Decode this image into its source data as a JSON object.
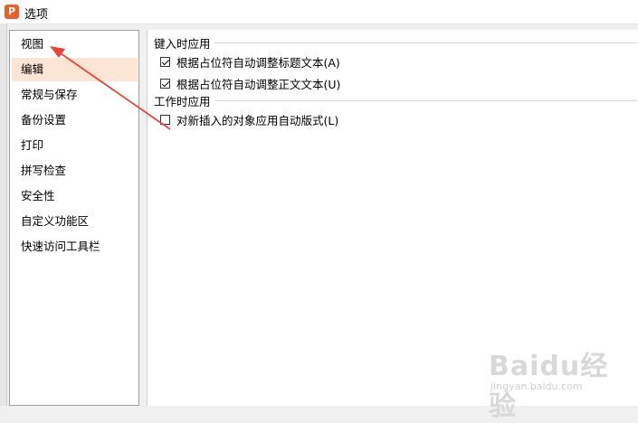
{
  "window": {
    "title": "选项",
    "app_icon_letter": "P",
    "accent_color": "#e8612a"
  },
  "sidebar": {
    "items": [
      {
        "label": "视图",
        "selected": false
      },
      {
        "label": "编辑",
        "selected": true
      },
      {
        "label": "常规与保存",
        "selected": false
      },
      {
        "label": "备份设置",
        "selected": false
      },
      {
        "label": "打印",
        "selected": false
      },
      {
        "label": "拼写检查",
        "selected": false
      },
      {
        "label": "安全性",
        "selected": false
      },
      {
        "label": "自定义功能区",
        "selected": false
      },
      {
        "label": "快速访问工具栏",
        "selected": false
      }
    ]
  },
  "content": {
    "group1": {
      "label": "键入时应用",
      "options": [
        {
          "label": "根据占位符自动调整标题文本(A)",
          "checked": true
        },
        {
          "label": "根据占位符自动调整正文文本(U)",
          "checked": true
        }
      ]
    },
    "group2": {
      "label": "工作时应用",
      "options": [
        {
          "label": "对新插入的对象应用自动版式(L)",
          "checked": false
        }
      ]
    }
  },
  "annotation": {
    "arrow_color": "#e8463c"
  },
  "watermark": {
    "logo": "Baidu经验",
    "url": "jingyan.baidu.com"
  }
}
